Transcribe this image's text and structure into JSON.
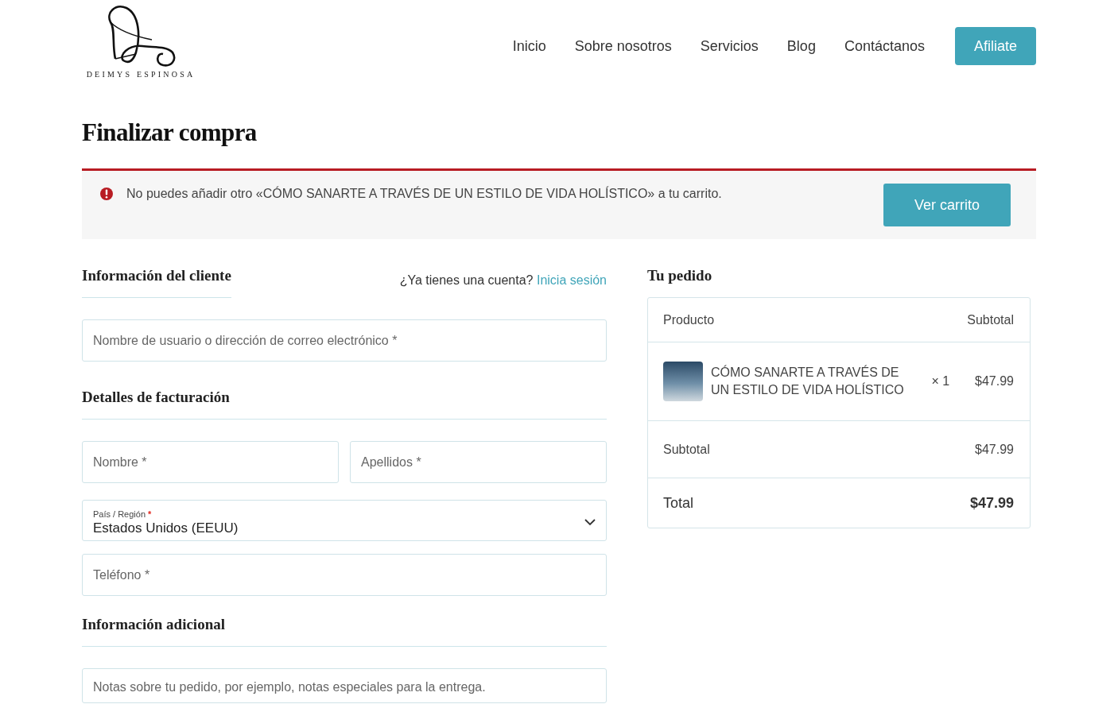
{
  "header": {
    "brand": "DEIMYS ESPINOSA",
    "nav": [
      "Inicio",
      "Sobre nosotros",
      "Servicios",
      "Blog",
      "Contáctanos"
    ],
    "cta": "Afiliate"
  },
  "page_title": "Finalizar compra",
  "notice": {
    "message": "No puedes añadir otro «CÓMO SANARTE A TRAVÉS DE UN ESTILO DE VIDA HOLÍSTICO» a tu carrito.",
    "button": "Ver carrito"
  },
  "customer": {
    "heading": "Información del cliente",
    "login_prompt": "¿Ya tienes una cuenta?",
    "login_link": "Inicia sesión",
    "email_placeholder": "Nombre de usuario o dirección de correo electrónico *"
  },
  "billing": {
    "heading": "Detalles de facturación",
    "first_name_placeholder": "Nombre *",
    "last_name_placeholder": "Apellidos *",
    "country": {
      "label": "País / Región",
      "required_mark": "*",
      "value": "Estados Unidos (EEUU)"
    },
    "phone_placeholder": "Teléfono *"
  },
  "additional": {
    "heading": "Información adicional",
    "notes_placeholder": "Notas sobre tu pedido, por ejemplo, notas especiales para la entrega."
  },
  "order": {
    "heading": "Tu pedido",
    "columns": [
      "Producto",
      "Subtotal"
    ],
    "items": [
      {
        "name": "CÓMO SANARTE A TRAVÉS DE UN ESTILO DE VIDA HOLÍSTICO",
        "quantity": "× 1",
        "price": "$47.99"
      }
    ],
    "subtotal": {
      "label": "Subtotal",
      "value": "$47.99"
    },
    "total": {
      "label": "Total",
      "value": "$47.99"
    }
  }
}
